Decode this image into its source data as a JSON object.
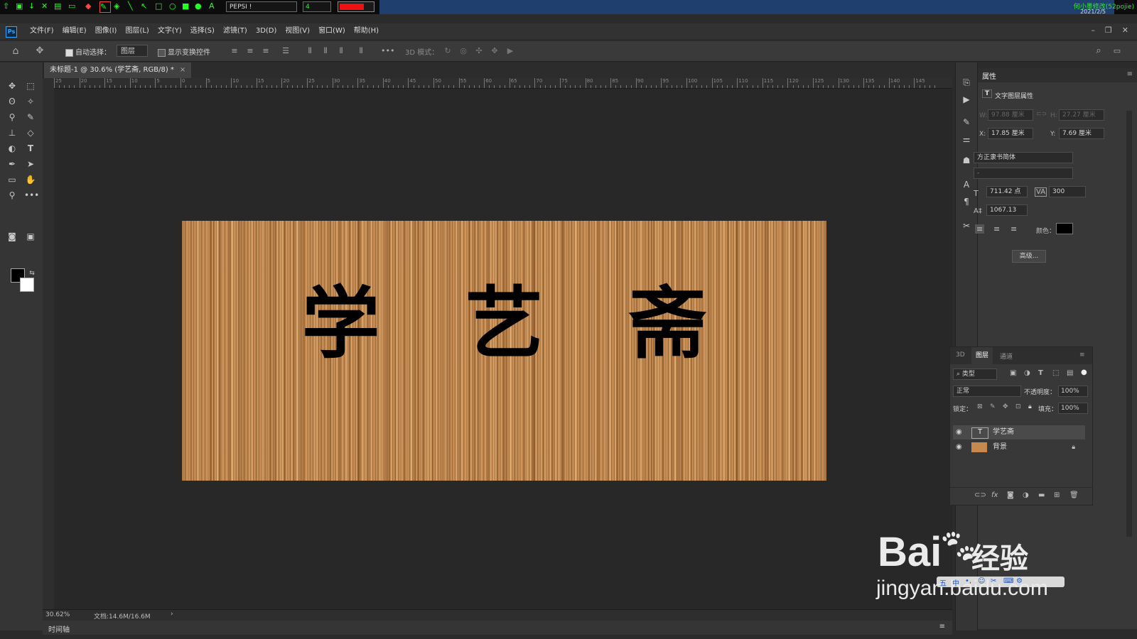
{
  "topstrip": {
    "font_box": "PEPSI !",
    "size_box": "4",
    "color": "#ee1111",
    "author": "何小墨修改(52pojie)",
    "date": "2021/2/5"
  },
  "menubar": {
    "items": [
      "文件(F)",
      "编辑(E)",
      "图像(I)",
      "图层(L)",
      "文字(Y)",
      "选择(S)",
      "滤镜(T)",
      "3D(D)",
      "视图(V)",
      "窗口(W)",
      "帮助(H)"
    ]
  },
  "optbar": {
    "auto_select_label": "自动选择：",
    "auto_select_checked": true,
    "auto_select_target": "图层",
    "show_transform_label": "显示变换控件",
    "mode_3d_label": "3D 模式："
  },
  "document": {
    "tab_title": "未标题-1 @ 30.6% (学艺斋, RGB/8) *",
    "canvas_text": "学艺斋",
    "wood_color": "#c68a4e"
  },
  "ruler": {
    "top_labels": [
      "25",
      "20",
      "15",
      "10",
      "5",
      "0",
      "5",
      "10",
      "15",
      "20",
      "25",
      "30",
      "35",
      "40",
      "45",
      "50",
      "55",
      "60",
      "65",
      "70",
      "75",
      "80",
      "85",
      "90",
      "95",
      "100",
      "105",
      "110",
      "115",
      "120",
      "125",
      "130",
      "135",
      "140",
      "145"
    ]
  },
  "statusbar": {
    "zoom": "30.62%",
    "doc_info": "文档:14.6M/16.6M"
  },
  "timeline": {
    "label": "时间轴"
  },
  "properties": {
    "tab": "属性",
    "section_title": "文字图层属性",
    "w_label": "W:",
    "w_value": "97.88 厘米",
    "h_label": "H:",
    "h_value": "27.27 厘米",
    "x_label": "X:",
    "x_value": "17.85 厘米",
    "y_label": "Y:",
    "y_value": "7.69 厘米",
    "font_family": "方正隶书简体",
    "font_style": "-",
    "font_size": "711.42 点",
    "tracking": "300",
    "leading": "1067.13",
    "color_label": "颜色：",
    "text_color": "#000000",
    "advanced_button": "高级..."
  },
  "layers": {
    "tabs": [
      "3D",
      "图层",
      "通道"
    ],
    "active_tab": "图层",
    "filter_type": "类型",
    "blend_mode": "正常",
    "opacity_label": "不透明度：",
    "opacity_value": "100%",
    "lock_label": "锁定：",
    "fill_label": "填充：",
    "fill_value": "100%",
    "items": [
      {
        "name": "学艺斋",
        "type": "text"
      },
      {
        "name": "背景",
        "type": "image"
      }
    ]
  },
  "watermark": {
    "brand": "Bai",
    "brand_suffix": "经验",
    "url": "jingyan.baidu.com"
  }
}
